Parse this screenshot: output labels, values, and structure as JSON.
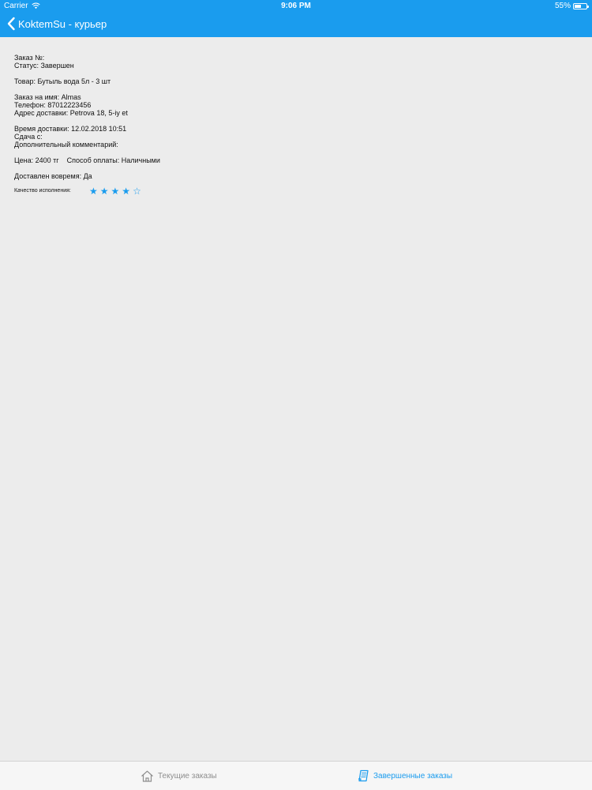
{
  "status_bar": {
    "carrier": "Carrier",
    "time": "9:06 PM",
    "battery_percent": "55%",
    "battery_level": 0.55
  },
  "nav": {
    "back_title": "KoktemSu - курьер"
  },
  "order": {
    "number_line": "Заказ №:",
    "status_line": "Статус: Завершен",
    "product_line": "Товар: Бутыль вода 5л - 3 шт",
    "customer_line": "Заказ на имя: Almas",
    "phone_line": "Телефон: 87012223456",
    "address_line": "Адрес доставки: Petrova 18, 5-iy et",
    "delivery_time_line": "Время доставки: 12.02.2018 10:51",
    "change_line": "Сдача с:",
    "comment_line": "Дополнительный комментарий:",
    "price_line": "Цена: 2400 тг",
    "payment_line": "Способ оплаты:  Наличными",
    "on_time_line": "Доставлен вовремя: Да",
    "quality_label": "Качество исполнения:",
    "rating": 4,
    "rating_max": 5
  },
  "tabs": {
    "current_label": "Текущие заказы",
    "completed_label": "Завершенные заказы"
  },
  "colors": {
    "accent": "#1a9cee",
    "background": "#ececec",
    "inactive_tab": "#8e8e8e"
  }
}
